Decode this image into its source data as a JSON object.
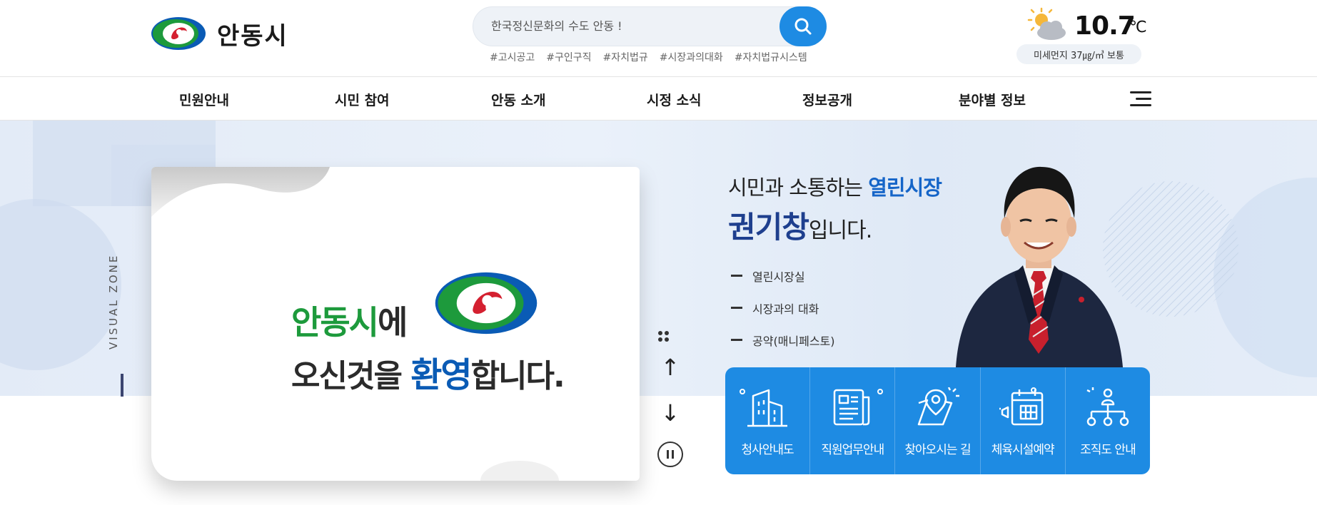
{
  "header": {
    "logo_text": "안동시",
    "search": {
      "placeholder": "한국정신문화의 수도 안동 !"
    },
    "tags": [
      "#고시공고",
      "#구인구직",
      "#자치법규",
      "#시장과의대화",
      "#자치법규시스템"
    ],
    "weather": {
      "icon": "partly-cloudy-icon",
      "temp": "10.7",
      "unit": "℃",
      "dust": "미세먼지 37㎍/㎥ 보통"
    }
  },
  "nav": {
    "items": [
      "민원안내",
      "시민 참여",
      "안동 소개",
      "시정 소식",
      "정보공개",
      "분야별 정보"
    ]
  },
  "visual": {
    "zone_label": "VISUAL ZONE",
    "welcome": {
      "line1_green": "안동시",
      "line1_dark": "에",
      "line2_pre": "오신것을 ",
      "line2_blue": "환영",
      "line2_post": "합니다."
    },
    "controls": {
      "up": "↑",
      "down": "↓"
    }
  },
  "mayor": {
    "line1_pre": "시민과 소통하는 ",
    "line1_blue": "열린시장",
    "name": "권기창",
    "name_suffix": "입니다.",
    "links": [
      "열린시장실",
      "시장과의 대화",
      "공약(매니페스토)"
    ]
  },
  "quick_menu": [
    {
      "label": "청사안내도",
      "icon": "building-icon"
    },
    {
      "label": "직원업무안내",
      "icon": "document-icon"
    },
    {
      "label": "찾아오시는 길",
      "icon": "map-pin-icon"
    },
    {
      "label": "체육시설예약",
      "icon": "calendar-icon"
    },
    {
      "label": "조직도 안내",
      "icon": "org-chart-icon"
    }
  ],
  "colors": {
    "accent": "#1e8be3",
    "logo_green": "#1d9a3c",
    "logo_blue": "#0a5bb5",
    "logo_red": "#d42030",
    "mayor_name": "#1e3f8e"
  }
}
